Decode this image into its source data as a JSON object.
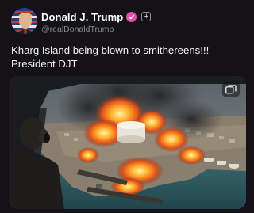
{
  "post": {
    "author": {
      "display_name": "Donald J. Trump",
      "handle": "@realDonaldTrump",
      "avatar_icon": "flag-portrait-avatar",
      "verified_icon": "verified-badge-icon",
      "verified_color": "#e34fa9"
    },
    "follow_label": "+",
    "text_lines": [
      "Kharg Island being blown to smithereens!!!",
      "President DJT"
    ],
    "media": {
      "type": "image",
      "expand_icon": "gallery-expand-icon"
    }
  },
  "colors": {
    "background": "#141217",
    "text": "#f2f2f4",
    "muted": "#8a8a92",
    "accent": "#e34fa9"
  }
}
